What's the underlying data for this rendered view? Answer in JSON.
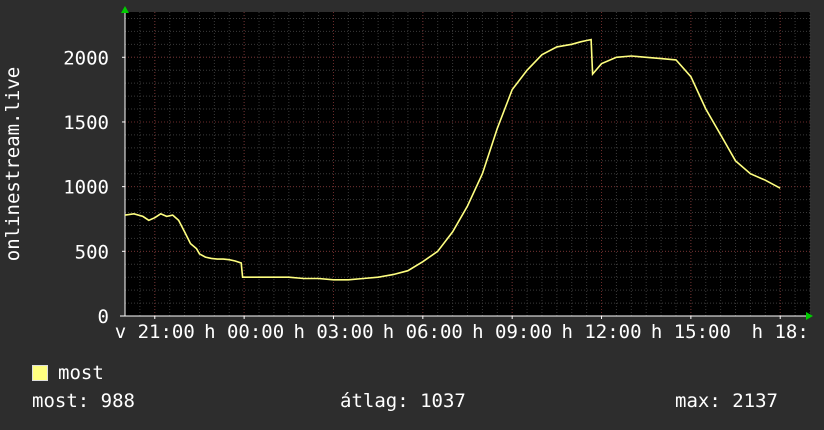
{
  "chart_data": {
    "type": "line",
    "ylabel": "onlinestream.live",
    "ylim": [
      0,
      2350
    ],
    "yticks": [
      0,
      500,
      1000,
      1500,
      2000
    ],
    "ytick_labels": [
      "0",
      "500",
      "1000",
      "1500",
      "2000"
    ],
    "xlim": [
      -4,
      19
    ],
    "xticks": [
      -3,
      0,
      3,
      6,
      9,
      12,
      15,
      18
    ],
    "xtick_labels": [
      "v 21:00",
      "h 00:00",
      "h 03:00",
      "h 06:00",
      "h 09:00",
      "h 12:00",
      "h 15:00",
      "h 18:"
    ],
    "grid": true,
    "colors": {
      "background": "#2d2d2d",
      "plot_background": "#000000",
      "grid_major": "#6b2a2a",
      "grid_minor": "#3a3a3a",
      "line": "#ffff80",
      "text": "#ffffff",
      "axis_arrow": "#00cc00"
    },
    "series": [
      {
        "name": "most",
        "color": "#ffff80",
        "x": [
          -4.0,
          -3.7,
          -3.4,
          -3.2,
          -3.0,
          -2.8,
          -2.6,
          -2.4,
          -2.2,
          -2.0,
          -1.8,
          -1.6,
          -1.5,
          -1.3,
          -1.1,
          -0.9,
          -0.7,
          -0.5,
          -0.3,
          -0.1,
          -0.05,
          0.0,
          0.5,
          1.0,
          1.5,
          2.0,
          2.5,
          3.0,
          3.5,
          4.0,
          4.5,
          5.0,
          5.5,
          6.0,
          6.5,
          7.0,
          7.5,
          8.0,
          8.5,
          9.0,
          9.5,
          10.0,
          10.5,
          11.0,
          11.3,
          11.5,
          11.65,
          11.7,
          12.0,
          12.5,
          13.0,
          13.5,
          14.0,
          14.5,
          15.0,
          15.5,
          16.0,
          16.5,
          17.0,
          17.5,
          18.0
        ],
        "y": [
          780,
          790,
          770,
          740,
          760,
          790,
          770,
          780,
          740,
          650,
          560,
          520,
          480,
          455,
          445,
          440,
          440,
          435,
          425,
          410,
          300,
          300,
          300,
          300,
          300,
          290,
          290,
          280,
          280,
          290,
          300,
          320,
          350,
          420,
          500,
          650,
          850,
          1100,
          1450,
          1750,
          1900,
          2020,
          2080,
          2100,
          2120,
          2130,
          2137,
          1870,
          1950,
          2000,
          2010,
          2000,
          1990,
          1980,
          1850,
          1600,
          1400,
          1200,
          1100,
          1050,
          988
        ]
      }
    ]
  },
  "legend": {
    "label": "most"
  },
  "stats": {
    "now": "most: 988",
    "avg": "átlag: 1037",
    "max": "max: 2137"
  }
}
